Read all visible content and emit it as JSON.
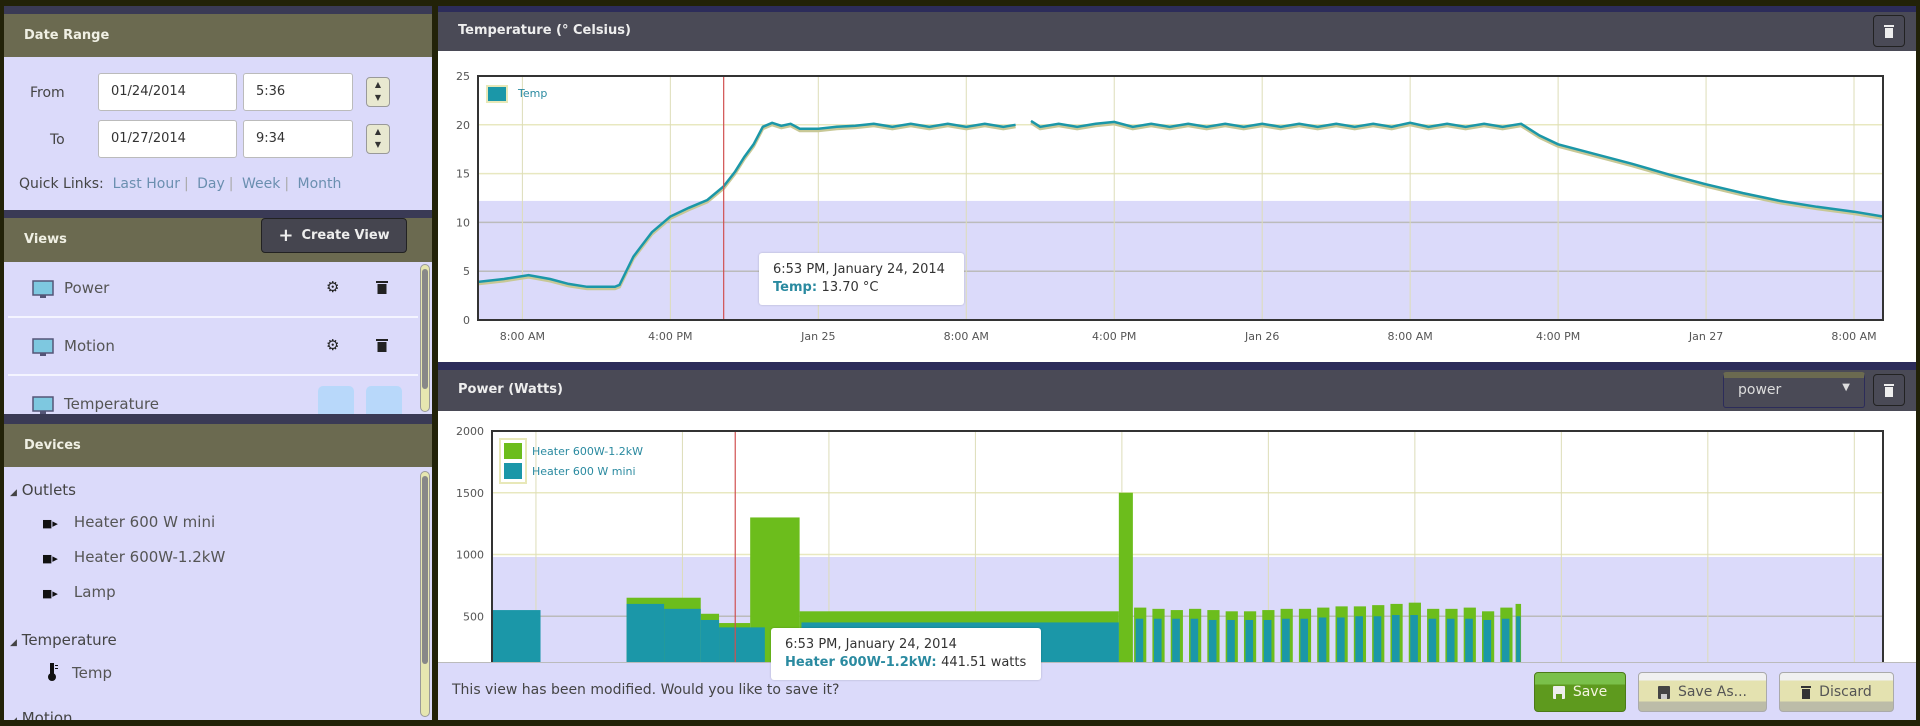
{
  "sidebar": {
    "date_range": {
      "title": "Date Range",
      "from_label": "From",
      "from_date": "01/24/2014",
      "from_time": "5:36",
      "to_label": "To",
      "to_date": "01/27/2014",
      "to_time": "9:34",
      "quick_links_label": "Quick Links:",
      "quick_links": [
        "Last Hour",
        "Day",
        "Week",
        "Month"
      ]
    },
    "views": {
      "title": "Views",
      "create_label": "Create View",
      "items": [
        {
          "label": "Power"
        },
        {
          "label": "Motion"
        },
        {
          "label": "Temperature",
          "selected": true
        }
      ]
    },
    "devices": {
      "title": "Devices",
      "groups": [
        {
          "label": "Outlets",
          "icon": "plug-icon",
          "items": [
            "Heater 600 W mini",
            "Heater 600W-1.2kW",
            "Lamp"
          ]
        },
        {
          "label": "Temperature",
          "icon": "thermometer-icon",
          "items": [
            "Temp"
          ]
        },
        {
          "label": "Motion",
          "items": []
        }
      ]
    }
  },
  "main": {
    "temperature_panel": {
      "title": "Temperature (° Celsius)"
    },
    "power_panel": {
      "title": "Power (Watts)",
      "select_value": "power"
    },
    "footer": {
      "message": "This view has been modified. Would you like to save it?",
      "save_label": "Save",
      "save_as_label": "Save As...",
      "discard_label": "Discard"
    }
  },
  "colors": {
    "teal": "#1b97a8",
    "green": "#6cbd1c",
    "crosshair": "#d05050",
    "lavender": "#dbdafa",
    "save_button": "#5e9a1e"
  },
  "chart_data": [
    {
      "type": "line",
      "title": "Temperature (° Celsius)",
      "x_range": [
        "2014-01-24 05:36",
        "2014-01-27 09:34"
      ],
      "ylim": [
        0,
        25
      ],
      "yticks": [
        0,
        5,
        10,
        15,
        20,
        25
      ],
      "xticks": [
        {
          "t": "2014-01-24 08:00",
          "label": "8:00 AM"
        },
        {
          "t": "2014-01-24 16:00",
          "label": "4:00 PM"
        },
        {
          "t": "2014-01-25 00:00",
          "label": "Jan 25"
        },
        {
          "t": "2014-01-25 08:00",
          "label": "8:00 AM"
        },
        {
          "t": "2014-01-25 16:00",
          "label": "4:00 PM"
        },
        {
          "t": "2014-01-26 00:00",
          "label": "Jan 26"
        },
        {
          "t": "2014-01-26 08:00",
          "label": "8:00 AM"
        },
        {
          "t": "2014-01-26 16:00",
          "label": "4:00 PM"
        },
        {
          "t": "2014-01-27 00:00",
          "label": "Jan 27"
        },
        {
          "t": "2014-01-27 08:00",
          "label": "8:00 AM"
        }
      ],
      "grid": true,
      "band": [
        0,
        12.2
      ],
      "legend": {
        "position": "top-left",
        "entries": [
          "Temp"
        ]
      },
      "series": [
        {
          "name": "Temp",
          "color": "#1b97a8",
          "points": [
            [
              "2014-01-24 05:36",
              3.9
            ],
            [
              "2014-01-24 07:00",
              4.2
            ],
            [
              "2014-01-24 08:20",
              4.6
            ],
            [
              "2014-01-24 09:30",
              4.2
            ],
            [
              "2014-01-24 10:30",
              3.7
            ],
            [
              "2014-01-24 11:30",
              3.4
            ],
            [
              "2014-01-24 13:00",
              3.4
            ],
            [
              "2014-01-24 13:15",
              3.6
            ],
            [
              "2014-01-24 14:00",
              6.5
            ],
            [
              "2014-01-24 15:00",
              9.0
            ],
            [
              "2014-01-24 16:00",
              10.6
            ],
            [
              "2014-01-24 17:00",
              11.5
            ],
            [
              "2014-01-24 18:00",
              12.3
            ],
            [
              "2014-01-24 18:53",
              13.7
            ],
            [
              "2014-01-24 19:30",
              15.2
            ],
            [
              "2014-01-24 20:00",
              16.7
            ],
            [
              "2014-01-24 20:30",
              18.0
            ],
            [
              "2014-01-24 21:00",
              19.8
            ],
            [
              "2014-01-24 21:30",
              20.2
            ],
            [
              "2014-01-24 22:00",
              19.9
            ],
            [
              "2014-01-24 22:30",
              20.1
            ],
            [
              "2014-01-24 23:00",
              19.6
            ],
            [
              "2014-01-25 00:00",
              19.6
            ],
            [
              "2014-01-25 01:00",
              19.8
            ],
            [
              "2014-01-25 02:00",
              19.9
            ],
            [
              "2014-01-25 03:00",
              20.1
            ],
            [
              "2014-01-25 04:00",
              19.8
            ],
            [
              "2014-01-25 05:00",
              20.1
            ],
            [
              "2014-01-25 06:00",
              19.8
            ],
            [
              "2014-01-25 07:00",
              20.1
            ],
            [
              "2014-01-25 08:00",
              19.8
            ],
            [
              "2014-01-25 09:00",
              20.1
            ],
            [
              "2014-01-25 10:00",
              19.8
            ],
            [
              "2014-01-25 10:40",
              20.0
            ],
            [
              "2014-01-25 11:00",
              null
            ],
            [
              "2014-01-25 11:30",
              20.4
            ],
            [
              "2014-01-25 12:00",
              19.8
            ],
            [
              "2014-01-25 13:00",
              20.1
            ],
            [
              "2014-01-25 14:00",
              19.8
            ],
            [
              "2014-01-25 15:00",
              20.1
            ],
            [
              "2014-01-25 16:00",
              20.3
            ],
            [
              "2014-01-25 17:00",
              19.8
            ],
            [
              "2014-01-25 18:00",
              20.1
            ],
            [
              "2014-01-25 19:00",
              19.8
            ],
            [
              "2014-01-25 20:00",
              20.1
            ],
            [
              "2014-01-25 21:00",
              19.8
            ],
            [
              "2014-01-25 22:00",
              20.1
            ],
            [
              "2014-01-25 23:00",
              19.8
            ],
            [
              "2014-01-26 00:00",
              20.1
            ],
            [
              "2014-01-26 01:00",
              19.8
            ],
            [
              "2014-01-26 02:00",
              20.1
            ],
            [
              "2014-01-26 03:00",
              19.8
            ],
            [
              "2014-01-26 04:00",
              20.1
            ],
            [
              "2014-01-26 05:00",
              19.8
            ],
            [
              "2014-01-26 06:00",
              20.1
            ],
            [
              "2014-01-26 07:00",
              19.8
            ],
            [
              "2014-01-26 08:00",
              20.2
            ],
            [
              "2014-01-26 09:00",
              19.8
            ],
            [
              "2014-01-26 10:00",
              20.1
            ],
            [
              "2014-01-26 11:00",
              19.8
            ],
            [
              "2014-01-26 12:00",
              20.1
            ],
            [
              "2014-01-26 13:00",
              19.8
            ],
            [
              "2014-01-26 14:00",
              20.1
            ],
            [
              "2014-01-26 15:00",
              18.9
            ],
            [
              "2014-01-26 16:00",
              18.0
            ],
            [
              "2014-01-26 18:00",
              17.0
            ],
            [
              "2014-01-26 20:00",
              16.0
            ],
            [
              "2014-01-26 22:00",
              14.9
            ],
            [
              "2014-01-27 00:00",
              13.9
            ],
            [
              "2014-01-27 02:00",
              13.0
            ],
            [
              "2014-01-27 04:00",
              12.2
            ],
            [
              "2014-01-27 06:00",
              11.6
            ],
            [
              "2014-01-27 08:00",
              11.1
            ],
            [
              "2014-01-27 09:34",
              10.6
            ]
          ]
        }
      ],
      "crosshair": "2014-01-24 18:53",
      "tooltip": {
        "title": "6:53 PM, January 24, 2014",
        "series": "Temp",
        "value": "13.70 °C"
      }
    },
    {
      "type": "area",
      "title": "Power (Watts)",
      "x_range": [
        "2014-01-24 05:36",
        "2014-01-27 09:34"
      ],
      "ylim": [
        0,
        2000
      ],
      "yticks": [
        500,
        1000,
        1500,
        2000
      ],
      "xticks": [
        "2014-01-24 08:00",
        "2014-01-24 16:00",
        "2014-01-25 00:00",
        "2014-01-25 08:00",
        "2014-01-25 16:00",
        "2014-01-26 00:00",
        "2014-01-26 08:00",
        "2014-01-26 16:00",
        "2014-01-27 00:00",
        "2014-01-27 08:00"
      ],
      "grid": true,
      "band": [
        0,
        980
      ],
      "legend": {
        "position": "top-left",
        "entries": [
          "Heater 600W-1.2kW",
          "Heater 600 W mini"
        ]
      },
      "series": [
        {
          "name": "Heater 600W-1.2kW",
          "color": "#6cbd1c",
          "segments_watts": [
            [
              "2014-01-24 12:57",
              "2014-01-24 17:00",
              650
            ],
            [
              "2014-01-24 17:00",
              "2014-01-24 18:00",
              520
            ],
            [
              "2014-01-24 18:00",
              "2014-01-24 19:42",
              445
            ],
            [
              "2014-01-24 19:42",
              "2014-01-24 22:24",
              1300
            ],
            [
              "2014-01-24 22:24",
              "2014-01-25 15:50",
              540
            ],
            [
              "2014-01-25 15:50",
              "2014-01-25 16:36",
              1500
            ],
            [
              "2014-01-25 16:40",
              "2014-01-25 17:20",
              570
            ],
            [
              "2014-01-25 17:40",
              "2014-01-25 18:20",
              560
            ],
            [
              "2014-01-25 18:40",
              "2014-01-25 19:20",
              550
            ],
            [
              "2014-01-25 19:40",
              "2014-01-25 20:20",
              560
            ],
            [
              "2014-01-25 20:40",
              "2014-01-25 21:20",
              550
            ],
            [
              "2014-01-25 21:40",
              "2014-01-25 22:20",
              540
            ],
            [
              "2014-01-25 22:40",
              "2014-01-25 23:20",
              540
            ],
            [
              "2014-01-25 23:40",
              "2014-01-26 00:20",
              550
            ],
            [
              "2014-01-26 00:40",
              "2014-01-26 01:20",
              560
            ],
            [
              "2014-01-26 01:40",
              "2014-01-26 02:20",
              560
            ],
            [
              "2014-01-26 02:40",
              "2014-01-26 03:20",
              570
            ],
            [
              "2014-01-26 03:40",
              "2014-01-26 04:20",
              580
            ],
            [
              "2014-01-26 04:40",
              "2014-01-26 05:20",
              580
            ],
            [
              "2014-01-26 05:40",
              "2014-01-26 06:20",
              590
            ],
            [
              "2014-01-26 06:40",
              "2014-01-26 07:20",
              600
            ],
            [
              "2014-01-26 07:40",
              "2014-01-26 08:20",
              610
            ],
            [
              "2014-01-26 08:40",
              "2014-01-26 09:20",
              560
            ],
            [
              "2014-01-26 09:40",
              "2014-01-26 10:20",
              560
            ],
            [
              "2014-01-26 10:40",
              "2014-01-26 11:20",
              570
            ],
            [
              "2014-01-26 11:40",
              "2014-01-26 12:20",
              540
            ],
            [
              "2014-01-26 12:40",
              "2014-01-26 13:20",
              570
            ],
            [
              "2014-01-26 13:30",
              "2014-01-26 13:48",
              600
            ]
          ]
        },
        {
          "name": "Heater 600 W mini",
          "color": "#1b97a8",
          "segments_watts": [
            [
              "2014-01-24 05:36",
              "2014-01-24 08:15",
              550
            ],
            [
              "2014-01-24 12:57",
              "2014-01-24 15:00",
              600
            ],
            [
              "2014-01-24 15:00",
              "2014-01-24 17:00",
              560
            ],
            [
              "2014-01-24 17:00",
              "2014-01-24 18:00",
              470
            ],
            [
              "2014-01-24 18:00",
              "2014-01-24 20:30",
              410
            ],
            [
              "2014-01-24 22:30",
              "2014-01-25 15:50",
              450
            ],
            [
              "2014-01-25 16:45",
              "2014-01-25 17:10",
              480
            ],
            [
              "2014-01-25 17:45",
              "2014-01-25 18:10",
              480
            ],
            [
              "2014-01-25 18:45",
              "2014-01-25 19:10",
              480
            ],
            [
              "2014-01-25 19:45",
              "2014-01-25 20:10",
              480
            ],
            [
              "2014-01-25 20:45",
              "2014-01-25 21:10",
              470
            ],
            [
              "2014-01-25 21:45",
              "2014-01-25 22:10",
              470
            ],
            [
              "2014-01-25 22:45",
              "2014-01-25 23:10",
              470
            ],
            [
              "2014-01-25 23:45",
              "2014-01-26 00:10",
              470
            ],
            [
              "2014-01-26 00:45",
              "2014-01-26 01:10",
              480
            ],
            [
              "2014-01-26 01:45",
              "2014-01-26 02:10",
              480
            ],
            [
              "2014-01-26 02:45",
              "2014-01-26 03:10",
              490
            ],
            [
              "2014-01-26 03:45",
              "2014-01-26 04:10",
              490
            ],
            [
              "2014-01-26 04:45",
              "2014-01-26 05:10",
              500
            ],
            [
              "2014-01-26 05:45",
              "2014-01-26 06:10",
              500
            ],
            [
              "2014-01-26 06:45",
              "2014-01-26 07:10",
              510
            ],
            [
              "2014-01-26 07:45",
              "2014-01-26 08:10",
              510
            ],
            [
              "2014-01-26 08:45",
              "2014-01-26 09:10",
              480
            ],
            [
              "2014-01-26 09:45",
              "2014-01-26 10:10",
              480
            ],
            [
              "2014-01-26 10:45",
              "2014-01-26 11:10",
              480
            ],
            [
              "2014-01-26 11:45",
              "2014-01-26 12:10",
              470
            ],
            [
              "2014-01-26 12:45",
              "2014-01-26 13:10",
              480
            ],
            [
              "2014-01-26 13:32",
              "2014-01-26 13:46",
              500
            ]
          ]
        }
      ],
      "crosshair": "2014-01-24 18:53",
      "tooltip": {
        "title": "6:53 PM, January 24, 2014",
        "series": "Heater 600W-1.2kW",
        "value": "441.51 watts"
      }
    }
  ]
}
